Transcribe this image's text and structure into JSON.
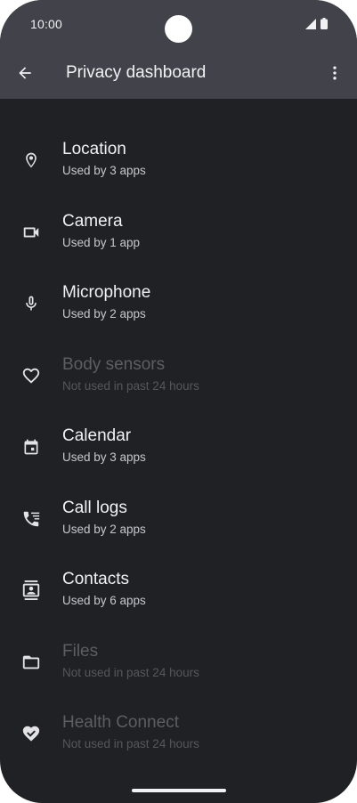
{
  "status_bar": {
    "time": "10:00"
  },
  "toolbar": {
    "title": "Privacy dashboard",
    "back_icon": "arrow-back-icon",
    "menu_icon": "more-vert-icon"
  },
  "colors": {
    "background": "#202124",
    "appbar": "#42434a",
    "text_primary": "#f1f1f4",
    "text_secondary": "#c6c7cf",
    "text_disabled": "#5c5e64"
  },
  "permissions": [
    {
      "name": "Location",
      "usage": "Used by 3 apps",
      "icon": "location-pin-icon",
      "enabled": true
    },
    {
      "name": "Camera",
      "usage": "Used by 1 app",
      "icon": "videocam-icon",
      "enabled": true
    },
    {
      "name": "Microphone",
      "usage": "Used by 2 apps",
      "icon": "mic-icon",
      "enabled": true
    },
    {
      "name": "Body sensors",
      "usage": "Not used in past 24 hours",
      "icon": "heart-icon",
      "enabled": false
    },
    {
      "name": "Calendar",
      "usage": "Used by 3 apps",
      "icon": "calendar-icon",
      "enabled": true
    },
    {
      "name": "Call logs",
      "usage": "Used by 2 apps",
      "icon": "call-log-icon",
      "enabled": true
    },
    {
      "name": "Contacts",
      "usage": "Used by 6 apps",
      "icon": "contacts-icon",
      "enabled": true
    },
    {
      "name": "Files",
      "usage": "Not used in past 24 hours",
      "icon": "folder-icon",
      "enabled": false
    },
    {
      "name": "Health Connect",
      "usage": "Not used in past 24 hours",
      "icon": "health-connect-icon",
      "enabled": false
    }
  ]
}
